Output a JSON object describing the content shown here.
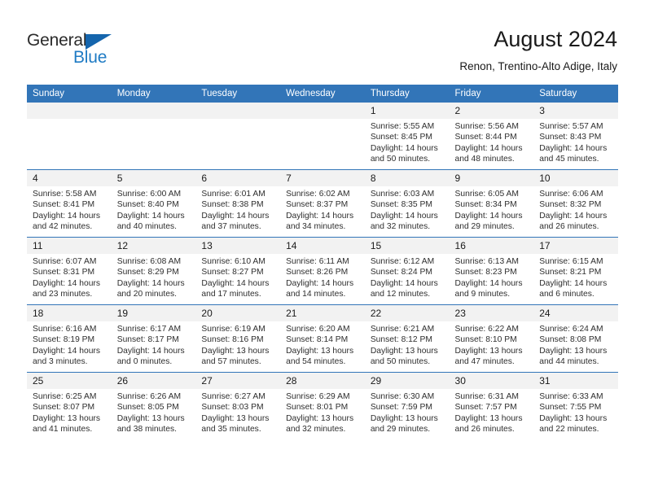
{
  "brand": {
    "name_part1": "General",
    "name_part2": "Blue",
    "triangle_icon": "triangle-icon",
    "color_dark": "#2b2b2b",
    "color_blue": "#1f7bc4"
  },
  "header": {
    "title": "August 2024",
    "subtitle": "Renon, Trentino-Alto Adige, Italy"
  },
  "theme": {
    "header_row_bg": "#3275b8",
    "daynum_bg": "#f2f2f2",
    "divider": "#3275b8",
    "text": "#1a1a1a"
  },
  "calendar": {
    "weekday_headers": [
      "Sunday",
      "Monday",
      "Tuesday",
      "Wednesday",
      "Thursday",
      "Friday",
      "Saturday"
    ],
    "weeks": [
      [
        {
          "day": "",
          "empty": true,
          "sunrise": "",
          "sunset": "",
          "daylight1": "",
          "daylight2": ""
        },
        {
          "day": "",
          "empty": true,
          "sunrise": "",
          "sunset": "",
          "daylight1": "",
          "daylight2": ""
        },
        {
          "day": "",
          "empty": true,
          "sunrise": "",
          "sunset": "",
          "daylight1": "",
          "daylight2": ""
        },
        {
          "day": "",
          "empty": true,
          "sunrise": "",
          "sunset": "",
          "daylight1": "",
          "daylight2": ""
        },
        {
          "day": "1",
          "sunrise": "Sunrise: 5:55 AM",
          "sunset": "Sunset: 8:45 PM",
          "daylight1": "Daylight: 14 hours",
          "daylight2": "and 50 minutes."
        },
        {
          "day": "2",
          "sunrise": "Sunrise: 5:56 AM",
          "sunset": "Sunset: 8:44 PM",
          "daylight1": "Daylight: 14 hours",
          "daylight2": "and 48 minutes."
        },
        {
          "day": "3",
          "sunrise": "Sunrise: 5:57 AM",
          "sunset": "Sunset: 8:43 PM",
          "daylight1": "Daylight: 14 hours",
          "daylight2": "and 45 minutes."
        }
      ],
      [
        {
          "day": "4",
          "sunrise": "Sunrise: 5:58 AM",
          "sunset": "Sunset: 8:41 PM",
          "daylight1": "Daylight: 14 hours",
          "daylight2": "and 42 minutes."
        },
        {
          "day": "5",
          "sunrise": "Sunrise: 6:00 AM",
          "sunset": "Sunset: 8:40 PM",
          "daylight1": "Daylight: 14 hours",
          "daylight2": "and 40 minutes."
        },
        {
          "day": "6",
          "sunrise": "Sunrise: 6:01 AM",
          "sunset": "Sunset: 8:38 PM",
          "daylight1": "Daylight: 14 hours",
          "daylight2": "and 37 minutes."
        },
        {
          "day": "7",
          "sunrise": "Sunrise: 6:02 AM",
          "sunset": "Sunset: 8:37 PM",
          "daylight1": "Daylight: 14 hours",
          "daylight2": "and 34 minutes."
        },
        {
          "day": "8",
          "sunrise": "Sunrise: 6:03 AM",
          "sunset": "Sunset: 8:35 PM",
          "daylight1": "Daylight: 14 hours",
          "daylight2": "and 32 minutes."
        },
        {
          "day": "9",
          "sunrise": "Sunrise: 6:05 AM",
          "sunset": "Sunset: 8:34 PM",
          "daylight1": "Daylight: 14 hours",
          "daylight2": "and 29 minutes."
        },
        {
          "day": "10",
          "sunrise": "Sunrise: 6:06 AM",
          "sunset": "Sunset: 8:32 PM",
          "daylight1": "Daylight: 14 hours",
          "daylight2": "and 26 minutes."
        }
      ],
      [
        {
          "day": "11",
          "sunrise": "Sunrise: 6:07 AM",
          "sunset": "Sunset: 8:31 PM",
          "daylight1": "Daylight: 14 hours",
          "daylight2": "and 23 minutes."
        },
        {
          "day": "12",
          "sunrise": "Sunrise: 6:08 AM",
          "sunset": "Sunset: 8:29 PM",
          "daylight1": "Daylight: 14 hours",
          "daylight2": "and 20 minutes."
        },
        {
          "day": "13",
          "sunrise": "Sunrise: 6:10 AM",
          "sunset": "Sunset: 8:27 PM",
          "daylight1": "Daylight: 14 hours",
          "daylight2": "and 17 minutes."
        },
        {
          "day": "14",
          "sunrise": "Sunrise: 6:11 AM",
          "sunset": "Sunset: 8:26 PM",
          "daylight1": "Daylight: 14 hours",
          "daylight2": "and 14 minutes."
        },
        {
          "day": "15",
          "sunrise": "Sunrise: 6:12 AM",
          "sunset": "Sunset: 8:24 PM",
          "daylight1": "Daylight: 14 hours",
          "daylight2": "and 12 minutes."
        },
        {
          "day": "16",
          "sunrise": "Sunrise: 6:13 AM",
          "sunset": "Sunset: 8:23 PM",
          "daylight1": "Daylight: 14 hours",
          "daylight2": "and 9 minutes."
        },
        {
          "day": "17",
          "sunrise": "Sunrise: 6:15 AM",
          "sunset": "Sunset: 8:21 PM",
          "daylight1": "Daylight: 14 hours",
          "daylight2": "and 6 minutes."
        }
      ],
      [
        {
          "day": "18",
          "sunrise": "Sunrise: 6:16 AM",
          "sunset": "Sunset: 8:19 PM",
          "daylight1": "Daylight: 14 hours",
          "daylight2": "and 3 minutes."
        },
        {
          "day": "19",
          "sunrise": "Sunrise: 6:17 AM",
          "sunset": "Sunset: 8:17 PM",
          "daylight1": "Daylight: 14 hours",
          "daylight2": "and 0 minutes."
        },
        {
          "day": "20",
          "sunrise": "Sunrise: 6:19 AM",
          "sunset": "Sunset: 8:16 PM",
          "daylight1": "Daylight: 13 hours",
          "daylight2": "and 57 minutes."
        },
        {
          "day": "21",
          "sunrise": "Sunrise: 6:20 AM",
          "sunset": "Sunset: 8:14 PM",
          "daylight1": "Daylight: 13 hours",
          "daylight2": "and 54 minutes."
        },
        {
          "day": "22",
          "sunrise": "Sunrise: 6:21 AM",
          "sunset": "Sunset: 8:12 PM",
          "daylight1": "Daylight: 13 hours",
          "daylight2": "and 50 minutes."
        },
        {
          "day": "23",
          "sunrise": "Sunrise: 6:22 AM",
          "sunset": "Sunset: 8:10 PM",
          "daylight1": "Daylight: 13 hours",
          "daylight2": "and 47 minutes."
        },
        {
          "day": "24",
          "sunrise": "Sunrise: 6:24 AM",
          "sunset": "Sunset: 8:08 PM",
          "daylight1": "Daylight: 13 hours",
          "daylight2": "and 44 minutes."
        }
      ],
      [
        {
          "day": "25",
          "sunrise": "Sunrise: 6:25 AM",
          "sunset": "Sunset: 8:07 PM",
          "daylight1": "Daylight: 13 hours",
          "daylight2": "and 41 minutes."
        },
        {
          "day": "26",
          "sunrise": "Sunrise: 6:26 AM",
          "sunset": "Sunset: 8:05 PM",
          "daylight1": "Daylight: 13 hours",
          "daylight2": "and 38 minutes."
        },
        {
          "day": "27",
          "sunrise": "Sunrise: 6:27 AM",
          "sunset": "Sunset: 8:03 PM",
          "daylight1": "Daylight: 13 hours",
          "daylight2": "and 35 minutes."
        },
        {
          "day": "28",
          "sunrise": "Sunrise: 6:29 AM",
          "sunset": "Sunset: 8:01 PM",
          "daylight1": "Daylight: 13 hours",
          "daylight2": "and 32 minutes."
        },
        {
          "day": "29",
          "sunrise": "Sunrise: 6:30 AM",
          "sunset": "Sunset: 7:59 PM",
          "daylight1": "Daylight: 13 hours",
          "daylight2": "and 29 minutes."
        },
        {
          "day": "30",
          "sunrise": "Sunrise: 6:31 AM",
          "sunset": "Sunset: 7:57 PM",
          "daylight1": "Daylight: 13 hours",
          "daylight2": "and 26 minutes."
        },
        {
          "day": "31",
          "sunrise": "Sunrise: 6:33 AM",
          "sunset": "Sunset: 7:55 PM",
          "daylight1": "Daylight: 13 hours",
          "daylight2": "and 22 minutes."
        }
      ]
    ]
  }
}
